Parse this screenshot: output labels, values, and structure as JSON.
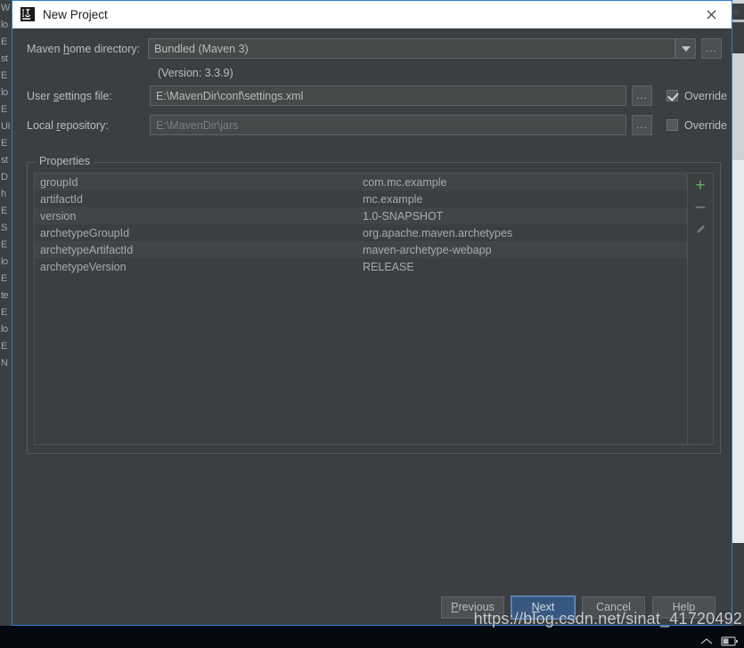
{
  "window": {
    "title": "New Project",
    "app_icon": "intellij-ij-logo-icon",
    "close_icon": "close-icon"
  },
  "form": {
    "maven_home": {
      "label_pre": "Maven ",
      "label_mnemonic": "h",
      "label_post": "ome directory:",
      "value": "Bundled (Maven 3)",
      "dropdown_icon": "chevron-down-icon",
      "browse_label": "...",
      "version_note": "(Version: 3.3.9)"
    },
    "user_settings": {
      "label_pre": "User ",
      "label_mnemonic": "s",
      "label_post": "ettings file:",
      "value": "E:\\MavenDir\\conf\\settings.xml",
      "browse_label": "...",
      "override_label": "Override",
      "override_checked": true
    },
    "local_repository": {
      "label_pre": "Local ",
      "label_mnemonic": "r",
      "label_post": "epository:",
      "value": "E:\\MavenDir\\jars",
      "browse_label": "...",
      "override_label": "Override",
      "override_checked": false
    }
  },
  "properties": {
    "legend": "Properties",
    "rows": [
      {
        "key": "groupId",
        "value": "com.mc.example"
      },
      {
        "key": "artifactId",
        "value": "mc.example"
      },
      {
        "key": "version",
        "value": "1.0-SNAPSHOT"
      },
      {
        "key": "archetypeGroupId",
        "value": "org.apache.maven.archetypes"
      },
      {
        "key": "archetypeArtifactId",
        "value": "maven-archetype-webapp"
      },
      {
        "key": "archetypeVersion",
        "value": "RELEASE"
      }
    ],
    "actions": {
      "add_label": "+",
      "remove_label": "–",
      "edit_icon": "pencil-edit-icon"
    }
  },
  "buttons": {
    "previous": {
      "pre": "",
      "mnemonic": "P",
      "post": "revious"
    },
    "next": {
      "pre": "",
      "mnemonic": "N",
      "post": "ext"
    },
    "cancel": {
      "pre": "Cancel",
      "mnemonic": "",
      "post": ""
    },
    "help": {
      "pre": "Help",
      "mnemonic": "",
      "post": ""
    }
  },
  "watermark": "https://blog.csdn.net/sinat_41720492",
  "background_text": {
    "left_fragments": [
      "W",
      "lo",
      "E",
      "st",
      "E",
      "lo",
      "E",
      "UI",
      "E",
      "st",
      "D",
      "h",
      "E",
      "S",
      "E",
      "lo",
      "E",
      "te",
      "E",
      "lo",
      "E",
      "N"
    ]
  },
  "colors": {
    "dialog_bg": "#3c3f41",
    "accent_border": "#2f7fd1",
    "field_bg": "#45494a",
    "default_button": "#365880",
    "add_green": "#62b562",
    "text": "#bbbbbb"
  }
}
